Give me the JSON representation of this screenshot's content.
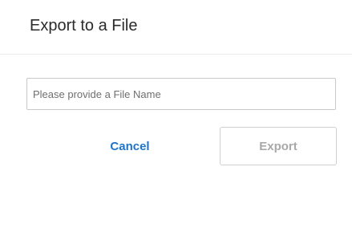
{
  "dialog": {
    "title": "Export to a File",
    "filename_input": {
      "value": "",
      "placeholder": "Please provide a File Name"
    },
    "cancel_label": "Cancel",
    "export_label": "Export",
    "export_disabled": true
  },
  "colors": {
    "title_text": "#2b2b2b",
    "cancel_link": "#1f74c9",
    "export_disabled_text": "#a9a9a9",
    "input_border": "#c9c9c9",
    "divider": "#ececec"
  }
}
